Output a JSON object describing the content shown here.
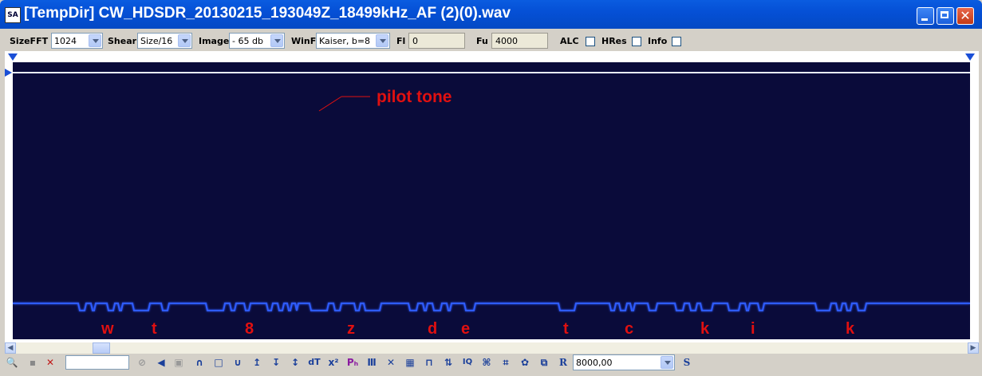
{
  "window": {
    "app_icon": "SA",
    "title": "[TempDir] CW_HDSDR_20130215_193049Z_18499kHz_AF (2)(0).wav",
    "close_glyph": "✕"
  },
  "toolbar": {
    "sizefft_label": "SizeFFT",
    "sizefft_value": "1024",
    "shear_label": "Shear",
    "shear_value": "Size/16",
    "image_label": "Image",
    "image_value": "- 65 db",
    "winf_label": "WinF",
    "winf_value": "Kaiser, b=8",
    "fl_label": "Fl",
    "fl_value": "0",
    "fu_label": "Fu",
    "fu_value": "4000",
    "alc_label": "ALC",
    "hres_label": "HRes",
    "info_label": "Info"
  },
  "annotation": {
    "pilot_label": "pilot tone",
    "annotation_color": "#e01010"
  },
  "morse_letters": [
    "w",
    "t",
    "8",
    "z",
    "d",
    "e",
    "t",
    "c",
    "k",
    "i",
    "k"
  ],
  "colors": {
    "spectrogram_bg": "#0a0b3a",
    "tone_line": "#2f5cff"
  },
  "bottom_toolbar": {
    "icons": [
      "zoom-icon",
      "save-icon",
      "delete-icon",
      "input-box",
      "cancel-icon",
      "speaker-icon",
      "stop-icon",
      "arch-icon",
      "rect-icon",
      "valley-icon",
      "arrows-up-icon",
      "arrows-down-icon",
      "arrows-updown-icon",
      "dt-icon",
      "x-power-icon",
      "ph-icon",
      "comb-icon",
      "crossing-icon",
      "grid-icon",
      "pulse-icon",
      "bars-icon",
      "iq-icon",
      "filter-a-icon",
      "filter-b-icon",
      "gear-icon",
      "copy-icon",
      "r-icon"
    ],
    "freq_value": "8000,00",
    "s_label": "S",
    "r_label": "R",
    "dt_label": "dT",
    "iq_label": "IQ"
  }
}
